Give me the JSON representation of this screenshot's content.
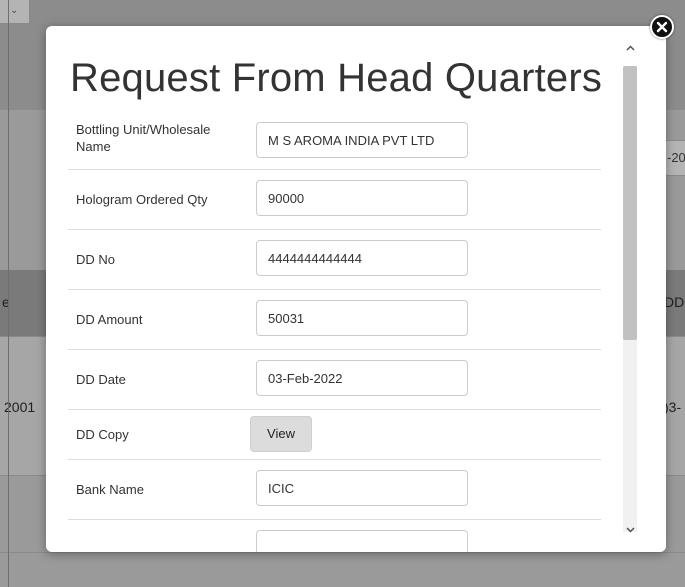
{
  "background": {
    "row_partial_left": "2001",
    "row_partial_right": ")3-",
    "header_partial_left": "e",
    "header_partial_right": "DD",
    "date_partial": "-20"
  },
  "modal": {
    "title": "Request From Head Quarters",
    "fields": [
      {
        "label": "Bottling Unit/Wholesale Name",
        "value": "M S AROMA INDIA PVT LTD"
      },
      {
        "label": "Hologram Ordered Qty",
        "value": "90000"
      },
      {
        "label": "DD No",
        "value": "4444444444444"
      },
      {
        "label": "DD Amount",
        "value": "50031"
      },
      {
        "label": "DD Date",
        "value": "03-Feb-2022"
      },
      {
        "label": "DD Copy",
        "button": "View"
      },
      {
        "label": "Bank Name",
        "value": "ICIC"
      }
    ]
  },
  "icons": {
    "close": "close-icon",
    "scroll_up": "chevron-up-icon",
    "scroll_down": "chevron-down-icon",
    "dropdown": "chevron-down-icon"
  }
}
